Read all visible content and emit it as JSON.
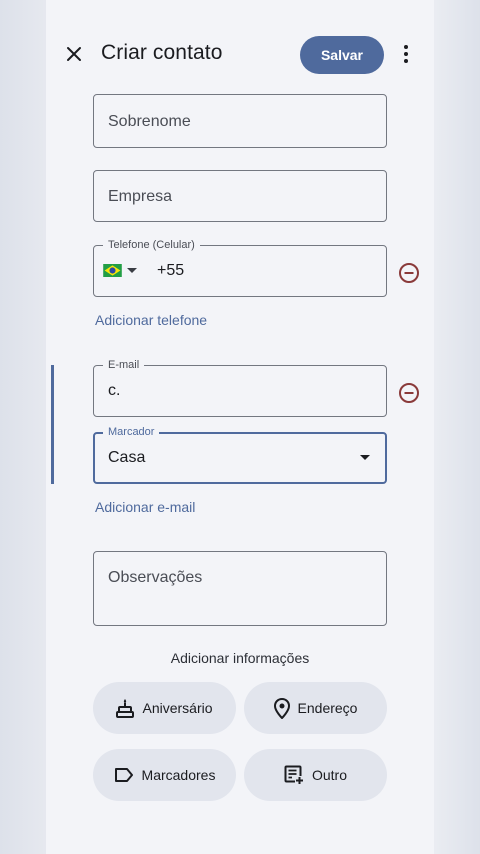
{
  "header": {
    "title": "Criar contato",
    "save_label": "Salvar"
  },
  "fields": {
    "last_name": {
      "placeholder": "Sobrenome"
    },
    "company": {
      "placeholder": "Empresa"
    },
    "phone": {
      "legend": "Telefone (Celular)",
      "country_code": "+55",
      "flag": "brazil-flag-icon"
    },
    "email": {
      "legend": "E-mail",
      "value": "c."
    },
    "label": {
      "legend": "Marcador",
      "value": "Casa"
    },
    "notes": {
      "placeholder": "Observações"
    }
  },
  "links": {
    "add_phone": "Adicionar telefone",
    "add_email": "Adicionar e-mail"
  },
  "more_info": {
    "title": "Adicionar informações",
    "chips": [
      {
        "label": "Aniversário",
        "icon": "cake-icon"
      },
      {
        "label": "Endereço",
        "icon": "location-pin-icon"
      },
      {
        "label": "Marcadores",
        "icon": "label-tag-icon"
      },
      {
        "label": "Outro",
        "icon": "add-notes-icon"
      }
    ]
  },
  "colors": {
    "accent": "#4f6a9d",
    "remove": "#8a3a3a",
    "background": "#f3f4f8",
    "chip": "#e2e5ed"
  }
}
